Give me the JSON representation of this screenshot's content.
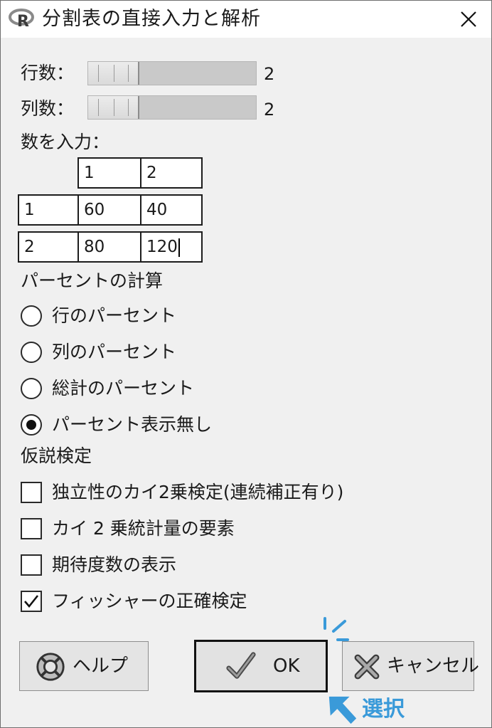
{
  "window": {
    "title": "分割表の直接入力と解析"
  },
  "rows": {
    "label": "行数：",
    "value": "2",
    "level": 0.0
  },
  "cols": {
    "label": "列数：",
    "value": "2",
    "level": 0.0
  },
  "input": {
    "label": "数を入力：",
    "col_headers": [
      "1",
      "2"
    ],
    "row_headers": [
      "1",
      "2"
    ],
    "cells": [
      [
        "60",
        "40"
      ],
      [
        "80",
        "120"
      ]
    ]
  },
  "percent": {
    "heading": "パーセントの計算",
    "options": [
      "行のパーセント",
      "列のパーセント",
      "総計のパーセント",
      "パーセント表示無し"
    ],
    "selected_index": 3
  },
  "tests": {
    "heading": "仮説検定",
    "options": [
      {
        "label": "独立性のカイ2乗検定(連続補正有り)",
        "checked": false
      },
      {
        "label": "カイ 2 乗統計量の要素",
        "checked": false
      },
      {
        "label": "期待度数の表示",
        "checked": false
      },
      {
        "label": "フィッシャーの正確検定",
        "checked": true
      }
    ]
  },
  "buttons": {
    "help": "ヘルプ",
    "ok": "OK",
    "cancel": "キャンセル"
  },
  "annotation": {
    "select_label": "選択",
    "color": "#3a9ad9"
  }
}
